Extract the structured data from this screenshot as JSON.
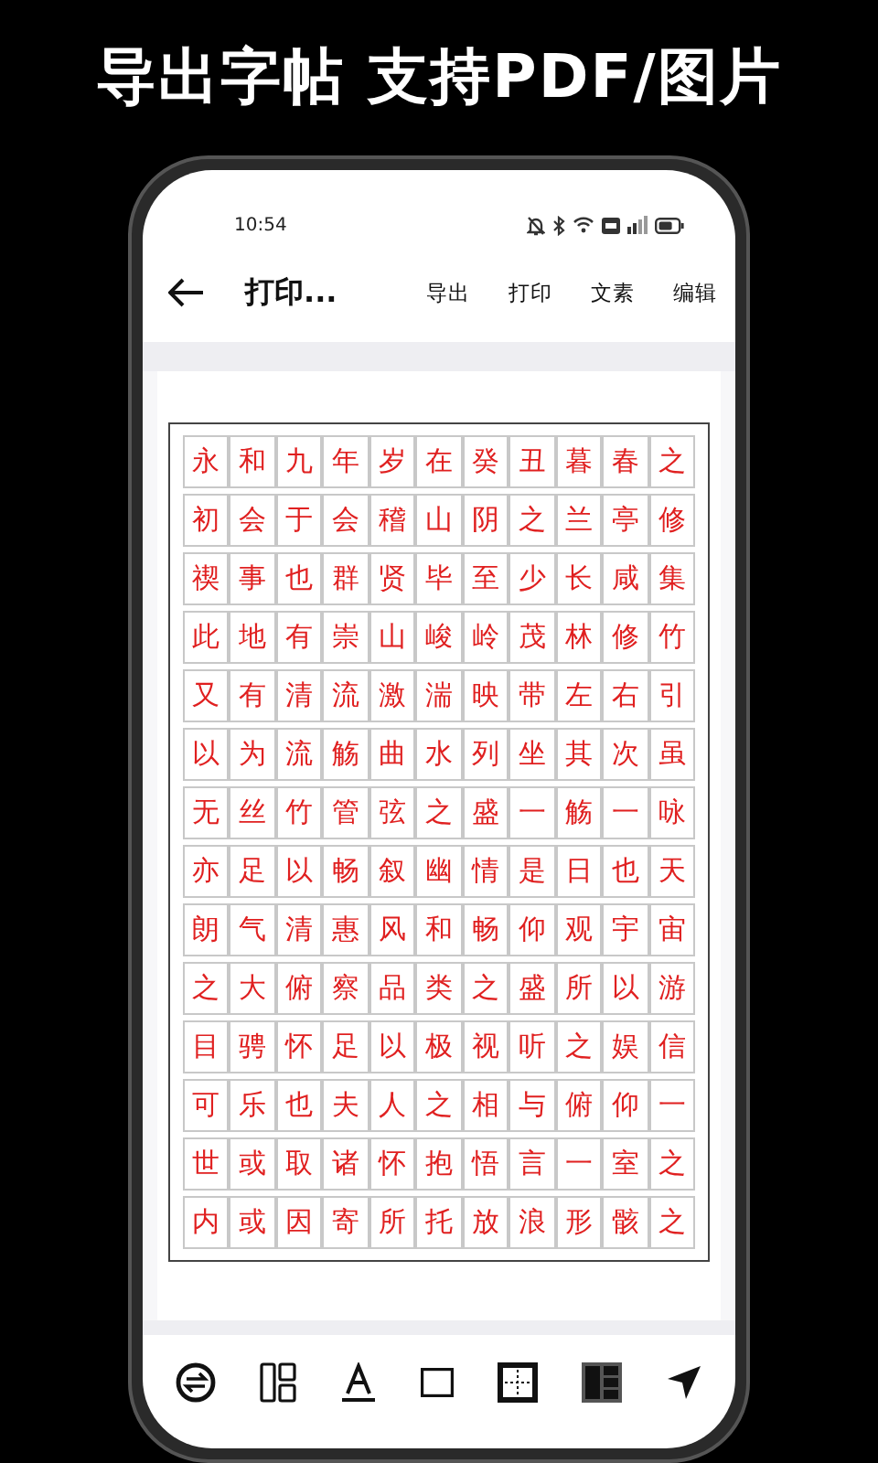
{
  "headline": "导出字帖 支持PDF/图片",
  "status_bar": {
    "time": "10:54"
  },
  "toolbar": {
    "title": "打印...",
    "actions": [
      "导出",
      "打印",
      "文素",
      "编辑"
    ]
  },
  "sheet": {
    "rows": [
      "永和九年岁在癸丑暮春之",
      "初会于会稽山阴之兰亭修",
      "禊事也群贤毕至少长咸集",
      "此地有崇山峻岭茂林修竹",
      "又有清流激湍映带左右引",
      "以为流觞曲水列坐其次虽",
      "无丝竹管弦之盛一觞一咏",
      "亦足以畅叙幽情是日也天",
      "朗气清惠风和畅仰观宇宙",
      "之大俯察品类之盛所以游",
      "目骋怀足以极视听之娱信",
      "可乐也夫人之相与俯仰一",
      "世或取诸怀抱悟言一室之",
      "内或因寄所托放浪形骸之"
    ]
  },
  "bottom_tools": [
    {
      "kind": "swap"
    },
    {
      "kind": "paper"
    },
    {
      "kind": "text_color"
    },
    {
      "kind": "cell_color"
    },
    {
      "kind": "grid_type"
    },
    {
      "kind": "layout"
    },
    {
      "kind": "send"
    }
  ]
}
